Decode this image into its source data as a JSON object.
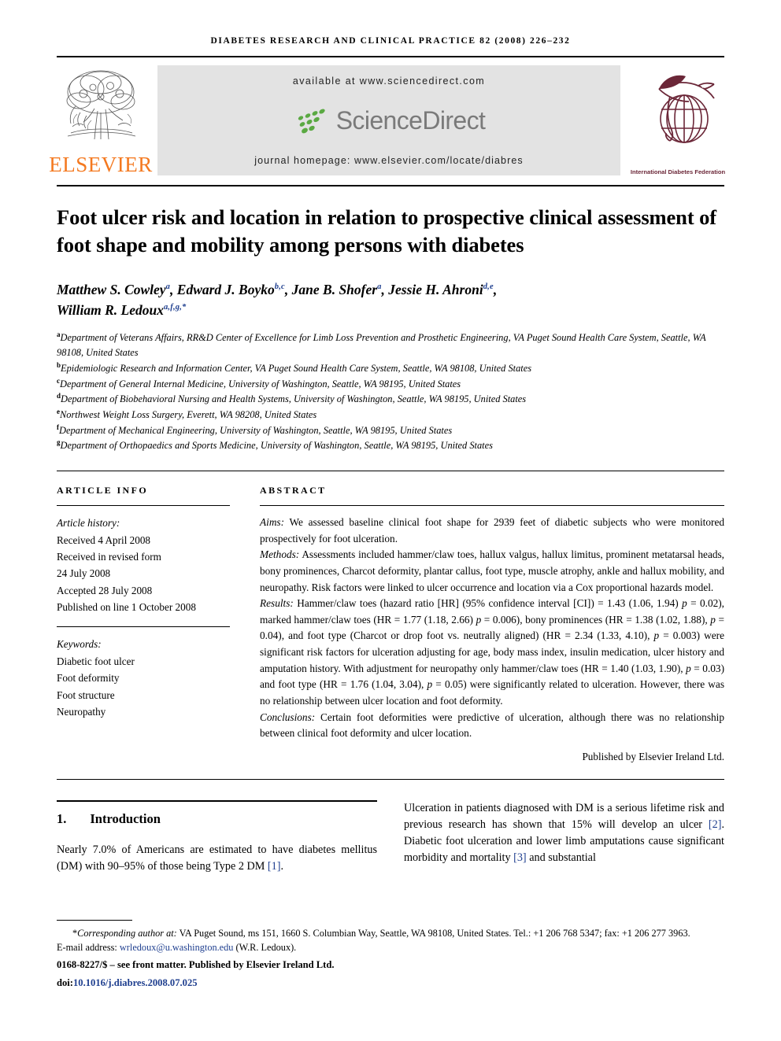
{
  "running_head": "Diabetes Research and Clinical Practice 82 (2008) 226–232",
  "masthead": {
    "elsevier_wordmark": "ELSEVIER",
    "available_at": "available at www.sciencedirect.com",
    "sciencedirect_wordmark": "ScienceDirect",
    "journal_homepage": "journal homepage: www.elsevier.com/locate/diabres",
    "idf_caption": "International Diabetes Federation",
    "colors": {
      "elsevier_orange": "#F47920",
      "sciencedirect_green": "#5aa942",
      "sciencedirect_gray": "#7a7a7a",
      "idf_maroon": "#6b2738",
      "banner_gray": "#e3e3e3",
      "link_blue": "#1f3f8f"
    }
  },
  "article": {
    "title": "Foot ulcer risk and location in relation to prospective clinical assessment of foot shape and mobility among persons with diabetes",
    "authors": [
      {
        "name": "Matthew S. Cowley",
        "marks": "a",
        "sep": ", "
      },
      {
        "name": "Edward J. Boyko",
        "marks": "b,c",
        "sep": ", "
      },
      {
        "name": "Jane B. Shofer",
        "marks": "a",
        "sep": ", "
      },
      {
        "name": "Jessie H. Ahroni",
        "marks": "d,e",
        "sep": ","
      },
      {
        "name": "William R. Ledoux",
        "marks": "a,f,g,*",
        "sep": ""
      }
    ],
    "affiliations": [
      {
        "mark": "a",
        "text": "Department of Veterans Affairs, RR&D Center of Excellence for Limb Loss Prevention and Prosthetic Engineering, VA Puget Sound Health Care System, Seattle, WA 98108, United States"
      },
      {
        "mark": "b",
        "text": "Epidemiologic Research and Information Center, VA Puget Sound Health Care System, Seattle, WA 98108, United States"
      },
      {
        "mark": "c",
        "text": "Department of General Internal Medicine, University of Washington, Seattle, WA 98195, United States"
      },
      {
        "mark": "d",
        "text": "Department of Biobehavioral Nursing and Health Systems, University of Washington, Seattle, WA 98195, United States"
      },
      {
        "mark": "e",
        "text": "Northwest Weight Loss Surgery, Everett, WA 98208, United States"
      },
      {
        "mark": "f",
        "text": "Department of Mechanical Engineering, University of Washington, Seattle, WA 98195, United States"
      },
      {
        "mark": "g",
        "text": "Department of Orthopaedics and Sports Medicine, University of Washington, Seattle, WA 98195, United States"
      }
    ]
  },
  "article_info": {
    "label": "Article info",
    "history_heading": "Article history:",
    "history": [
      "Received 4 April 2008",
      "Received in revised form",
      "24 July 2008",
      "Accepted 28 July 2008",
      "Published on line 1 October 2008"
    ],
    "keywords_heading": "Keywords:",
    "keywords": [
      "Diabetic foot ulcer",
      "Foot deformity",
      "Foot structure",
      "Neuropathy"
    ]
  },
  "abstract": {
    "label": "Abstract",
    "aims_head": "Aims:",
    "aims_text": " We assessed baseline clinical foot shape for 2939 feet of diabetic subjects who were monitored prospectively for foot ulceration.",
    "methods_head": "Methods:",
    "methods_text": " Assessments included hammer/claw toes, hallux valgus, hallux limitus, prominent metatarsal heads, bony prominences, Charcot deformity, plantar callus, foot type, muscle atrophy, ankle and hallux mobility, and neuropathy. Risk factors were linked to ulcer occurrence and location via a Cox proportional hazards model.",
    "results_head": "Results:",
    "results_text_1": " Hammer/claw toes (hazard ratio [HR] (95% confidence interval [CI]) = 1.43 (1.06, 1.94) ",
    "results_p1": "p",
    "results_text_2": " = 0.02), marked hammer/claw toes (HR = 1.77 (1.18, 2.66) ",
    "results_p2": "p",
    "results_text_3": " = 0.006), bony prominences (HR = 1.38 (1.02, 1.88), ",
    "results_p3": "p",
    "results_text_4": " = 0.04), and foot type (Charcot or drop foot vs. neutrally aligned) (HR = 2.34 (1.33, 4.10), ",
    "results_p4": "p",
    "results_text_5": " = 0.003) were significant risk factors for ulceration adjusting for age, body mass index, insulin medication, ulcer history and amputation history. With adjustment for neuropathy only hammer/claw toes (HR = 1.40 (1.03, 1.90), ",
    "results_p5": "p",
    "results_text_6": " = 0.03) and foot type (HR = 1.76 (1.04, 3.04), ",
    "results_p6": "p",
    "results_text_7": " = 0.05) were significantly related to ulceration. However, there was no relationship between ulcer location and foot deformity.",
    "conclusions_head": "Conclusions:",
    "conclusions_text": " Certain foot deformities were predictive of ulceration, although there was no relationship between clinical foot deformity and ulcer location.",
    "publisher_line": "Published by Elsevier Ireland Ltd."
  },
  "introduction": {
    "number": "1.",
    "heading": "Introduction",
    "left_text_1": "Nearly 7.0% of Americans are estimated to have diabetes mellitus (DM) with 90–95% of those being Type 2 DM ",
    "left_cite_1": "[1]",
    "left_text_2": ".",
    "right_text_1": "Ulceration in patients diagnosed with DM is a serious lifetime risk and previous research has shown that 15% will develop an ulcer ",
    "right_cite_1": "[2]",
    "right_text_2": ". Diabetic foot ulceration and lower limb amputations cause significant morbidity and mortality ",
    "right_cite_2": "[3]",
    "right_text_3": " and substantial"
  },
  "footer": {
    "corresponding_marker": "*",
    "corresponding_label": "Corresponding author at:",
    "corresponding_text": " VA Puget Sound, ms 151, 1660 S. Columbian Way, Seattle, WA 98108, United States. Tel.: +1 206 768 5347; fax: +1 206 277 3963.",
    "email_label": "E-mail address:",
    "email": "wrledoux@u.washington.edu",
    "email_suffix": " (W.R. Ledoux).",
    "issn_line": "0168-8227/$ – see front matter. Published by Elsevier Ireland Ltd.",
    "doi_label": "doi:",
    "doi": "10.1016/j.diabres.2008.07.025"
  }
}
